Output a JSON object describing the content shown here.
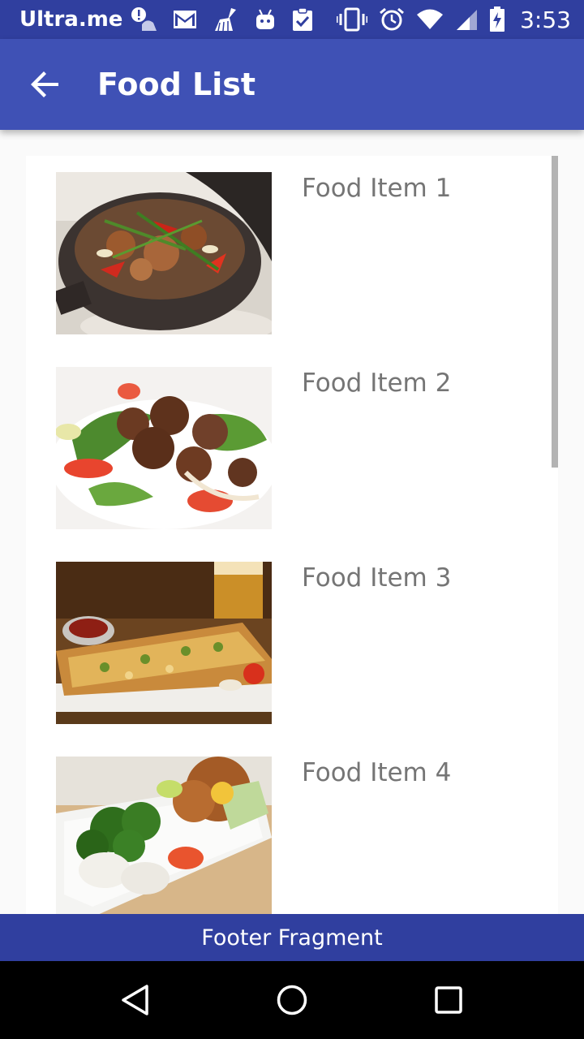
{
  "status_bar": {
    "carrier": "Ultra.me",
    "time": "3:53",
    "left_icons": [
      "alert-person-icon",
      "gmail-icon",
      "broom-icon",
      "android-icon",
      "clipboard-check-icon"
    ],
    "right_icons": [
      "vibrate-icon",
      "alarm-icon",
      "wifi-icon",
      "signal-icon",
      "battery-charging-icon"
    ]
  },
  "app_bar": {
    "title": "Food List",
    "back_icon": "arrow-back-icon",
    "color": "#3f51b5"
  },
  "food_list": {
    "items": [
      {
        "label": "Food Item 1",
        "image": "clay-pot-stir-fry-photo"
      },
      {
        "label": "Food Item 2",
        "image": "beef-salad-photo"
      },
      {
        "label": "Food Item 3",
        "image": "cheese-flatbread-photo"
      },
      {
        "label": "Food Item 4",
        "image": "bento-box-photo"
      }
    ]
  },
  "footer": {
    "label": "Footer Fragment",
    "color": "#303f9f"
  },
  "nav_bar": {
    "buttons": [
      "back-triangle-icon",
      "home-circle-icon",
      "recents-square-icon"
    ]
  }
}
